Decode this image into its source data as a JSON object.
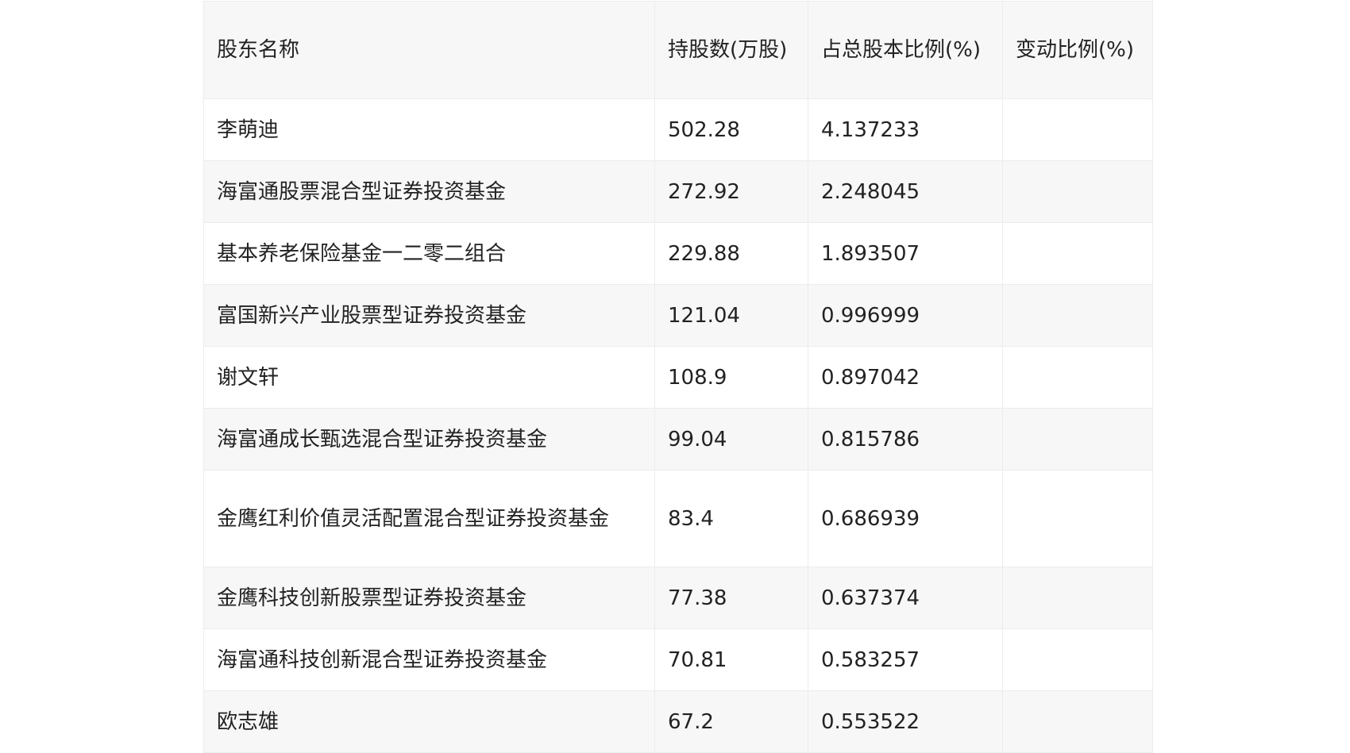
{
  "table": {
    "headers": [
      "股东名称",
      "持股数(万股)",
      "占总股本比例(%)",
      "变动比例(%)"
    ],
    "rows": [
      {
        "name": "李萌迪",
        "shares": "502.28",
        "ratio": "4.137233",
        "change": ""
      },
      {
        "name": "海富通股票混合型证券投资基金",
        "shares": "272.92",
        "ratio": "2.248045",
        "change": ""
      },
      {
        "name": "基本养老保险基金一二零二组合",
        "shares": "229.88",
        "ratio": "1.893507",
        "change": ""
      },
      {
        "name": "富国新兴产业股票型证券投资基金",
        "shares": "121.04",
        "ratio": "0.996999",
        "change": ""
      },
      {
        "name": "谢文轩",
        "shares": "108.9",
        "ratio": "0.897042",
        "change": ""
      },
      {
        "name": "海富通成长甄选混合型证券投资基金",
        "shares": "99.04",
        "ratio": "0.815786",
        "change": ""
      },
      {
        "name": "金鹰红利价值灵活配置混合型证券投资基金",
        "shares": "83.4",
        "ratio": "0.686939",
        "change": ""
      },
      {
        "name": "金鹰科技创新股票型证券投资基金",
        "shares": "77.38",
        "ratio": "0.637374",
        "change": ""
      },
      {
        "name": "海富通科技创新混合型证券投资基金",
        "shares": "70.81",
        "ratio": "0.583257",
        "change": ""
      },
      {
        "name": "欧志雄",
        "shares": "67.2",
        "ratio": "0.553522",
        "change": ""
      }
    ]
  }
}
